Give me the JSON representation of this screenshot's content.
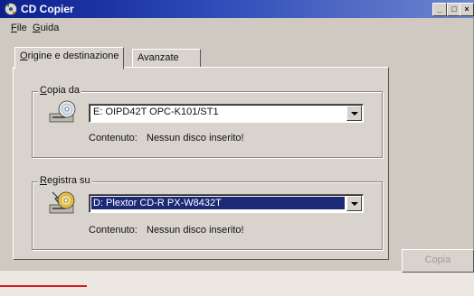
{
  "window": {
    "title": "CD Copier",
    "buttons": [
      "_",
      "□",
      "×"
    ]
  },
  "menu": [
    {
      "label": "File",
      "mnemonic": "F",
      "rest": "ile"
    },
    {
      "label": "Guida",
      "mnemonic": "G",
      "rest": "uida"
    }
  ],
  "tabs": [
    {
      "label": "Origine e destinazione",
      "mnemonic": "O",
      "rest": "rigine e destinazione",
      "active": true
    },
    {
      "label": "Avanzate",
      "active": false
    }
  ],
  "source": {
    "group_mnemonic": "C",
    "group_rest": "opia da",
    "drive": "E: OIPD42T OPC-K101/ST1",
    "contents_label": "Contenuto:",
    "contents_value": "Nessun disco inserito!"
  },
  "destination": {
    "group_mnemonic": "R",
    "group_rest": "egistra su",
    "drive": "D: Plextor CD-R PX-W8432T",
    "contents_label": "Contenuto:",
    "contents_value": "Nessun disco inserito!"
  },
  "copy_button": {
    "label": "Copia",
    "enabled": false
  },
  "colors": {
    "titlebar_start": "#0c1f8f",
    "selection": "#1c2a76",
    "accent_red": "#d11d1d"
  }
}
